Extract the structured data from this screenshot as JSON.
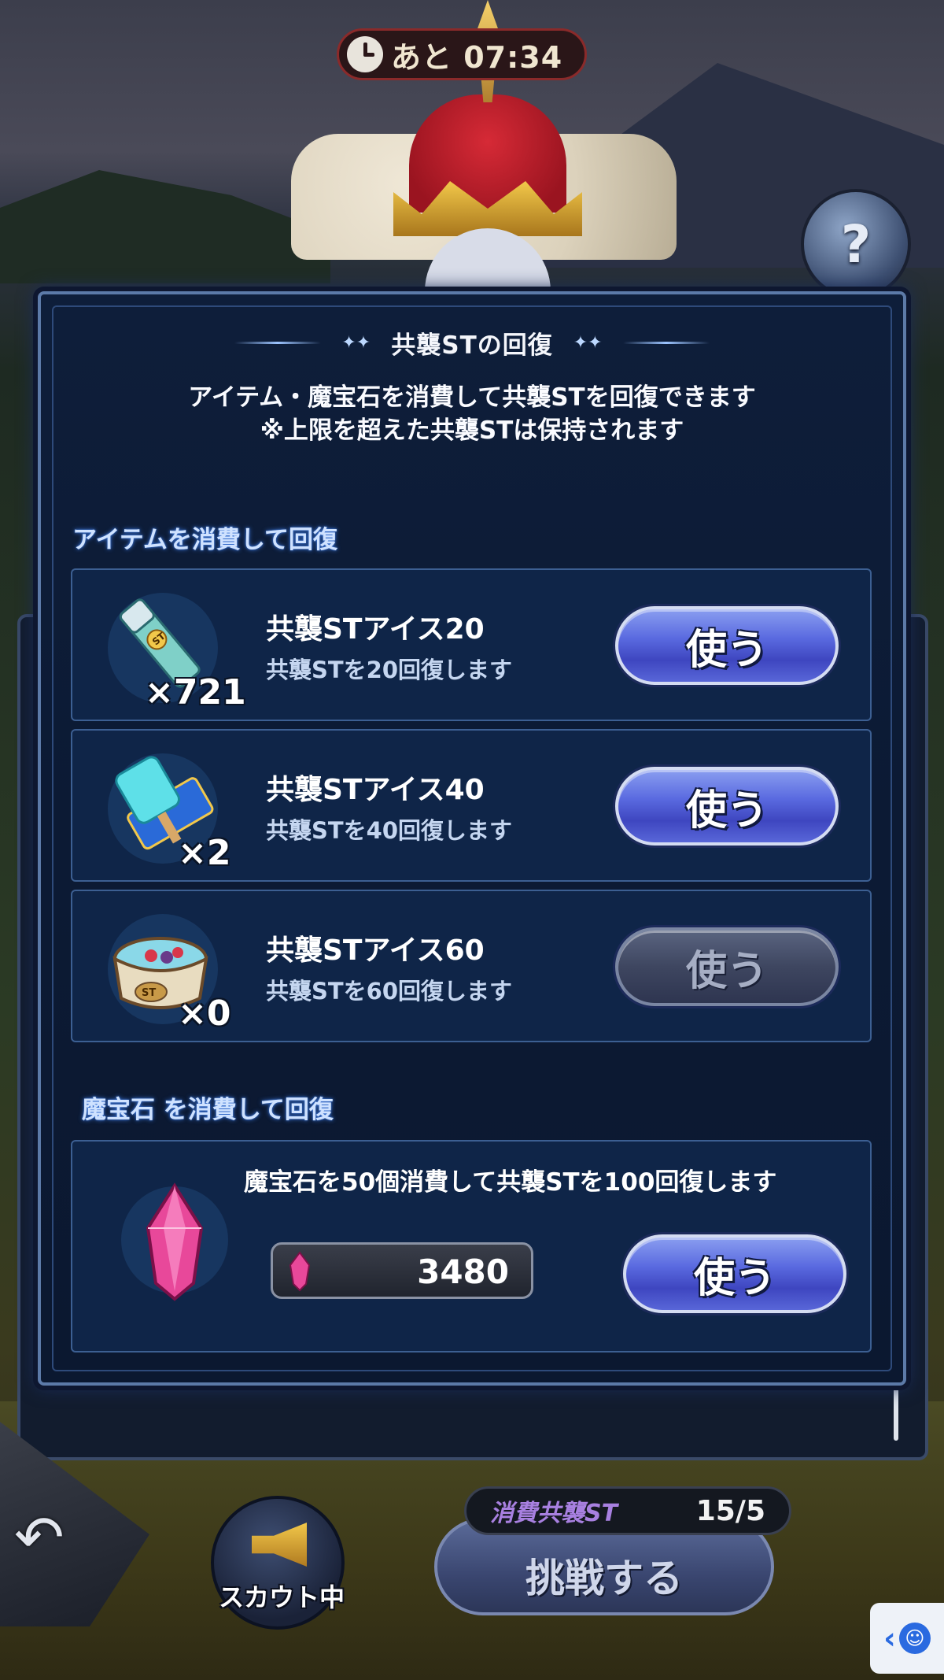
{
  "timer": {
    "text": "あと 07:34"
  },
  "help": {
    "label": "?"
  },
  "modal": {
    "title": "共襲STの回復",
    "description_line1": "アイテム・魔宝石を消費して共襲STを回復できます",
    "description_line2": "※上限を超えた共襲STは保持されます",
    "item_section_label": "アイテムを消費して回復",
    "items": [
      {
        "name": "共襲STアイス20",
        "desc": "共襲STを20回復します",
        "count": "×721",
        "button": "使う",
        "enabled": true
      },
      {
        "name": "共襲STアイス40",
        "desc": "共襲STを40回復します",
        "count": "×2",
        "button": "使う",
        "enabled": true
      },
      {
        "name": "共襲STアイス60",
        "desc": "共襲STを60回復します",
        "count": "×0",
        "button": "使う",
        "enabled": false
      }
    ],
    "gem_section_label": "魔宝石 を消費して回復",
    "gem": {
      "desc": "魔宝石を50個消費して共襲STを100回復します",
      "balance": "3480",
      "button": "使う"
    }
  },
  "bottom": {
    "back_icon": "↶",
    "scout_label": "スカウト中",
    "st_cost_label": "消費共襲ST",
    "st_cost_value": "15/5",
    "challenge_label": "挑戦する"
  },
  "colors": {
    "use_button": "#5a6ae0",
    "use_button_disabled": "#3e4660",
    "section_label": "#cfe2ff",
    "panel_bg": "#0f2548"
  }
}
